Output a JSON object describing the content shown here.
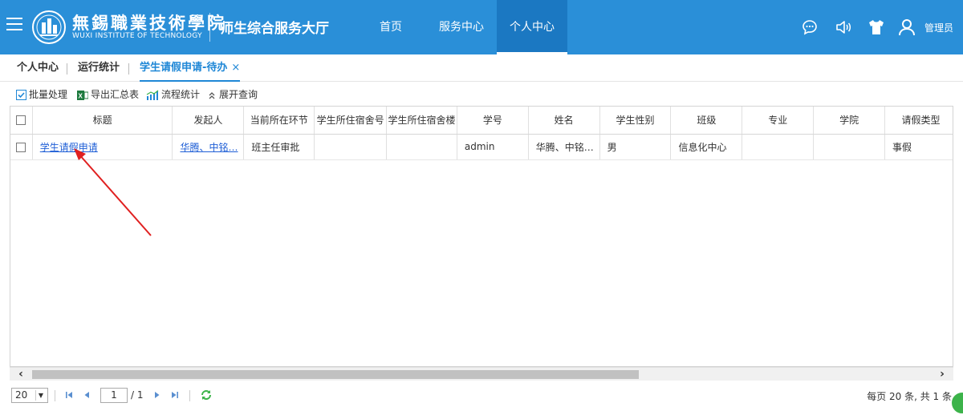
{
  "header": {
    "logo_cn": "無錫職業技術學院",
    "logo_en": "WUXI INSTITUTE OF TECHNOLOGY",
    "system_title": "师生综合服务大厅",
    "nav": [
      {
        "label": "首页",
        "active": false
      },
      {
        "label": "服务中心",
        "active": false
      },
      {
        "label": "个人中心",
        "active": true
      }
    ],
    "user_name": "管理员",
    "icons": [
      "menu-icon",
      "chat-icon",
      "speaker-icon",
      "shirt-icon",
      "user-icon"
    ]
  },
  "tabs": [
    {
      "label": "个人中心",
      "active": false
    },
    {
      "label": "运行统计",
      "active": false
    },
    {
      "label": "学生请假申请-待办",
      "active": true,
      "close": "×"
    }
  ],
  "toolbar": {
    "batch": "批量处理",
    "export": "导出汇总表",
    "flow_stats": "流程统计",
    "expand": "展开查询"
  },
  "table": {
    "columns": [
      "标题",
      "发起人",
      "当前所在环节",
      "学生所住宿舍号",
      "学生所住宿舍楼",
      "学号",
      "姓名",
      "学生性别",
      "班级",
      "专业",
      "学院",
      "请假类型"
    ],
    "rows": [
      [
        "学生请假申请",
        "华腾、中铭…",
        "班主任审批",
        "",
        "",
        "admin",
        "华腾、中铭…",
        "男",
        "信息化中心",
        "",
        "",
        "事假"
      ]
    ]
  },
  "pager": {
    "page_size": "20",
    "current_page": "1",
    "total_pages": "/ 1",
    "summary": "每页 20 条, 共 1 条"
  },
  "colors": {
    "header_bg": "#2a8fd8",
    "nav_active_bg": "#1b78c2",
    "accent": "#1f87d6",
    "annotation": "#e02020"
  }
}
